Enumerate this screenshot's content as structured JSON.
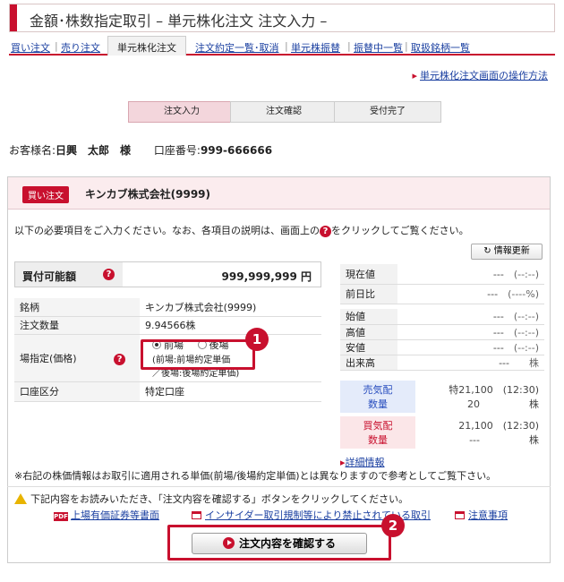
{
  "header": {
    "title": "金額･株数指定取引 – 単元株化注文 注文入力 –"
  },
  "tabs": [
    {
      "label": "買い注文"
    },
    {
      "label": "売り注文"
    },
    {
      "label": "単元株化注文"
    },
    {
      "label": "注文約定一覧･取消"
    },
    {
      "label": "単元株振替"
    },
    {
      "label": "振替中一覧"
    },
    {
      "label": "取扱銘柄一覧"
    }
  ],
  "help_link": "単元株化注文画面の操作方法",
  "steps": [
    "注文入力",
    "注文確認",
    "受付完了"
  ],
  "customer": {
    "name_label": "お客様名:",
    "name": "日興　太郎　様",
    "account_label": "口座番号:",
    "account": "999-666666"
  },
  "order": {
    "type_badge": "買い注文",
    "stock": "キンカブ株式会社(9999)"
  },
  "intro_before": "以下の必要項目をご入力ください。なお、各項目の説明は、画面上の",
  "intro_after": "をクリックしてご覧ください。",
  "refresh_label": "情報更新",
  "buying_power": {
    "label": "買付可能額",
    "value": "999,999,999 円"
  },
  "form": {
    "stock_label": "銘柄",
    "stock_value": "キンカブ株式会社(9999)",
    "qty_label": "注文数量",
    "qty_value": "9.94566株",
    "market_label": "場指定(価格)",
    "opt1": "前場",
    "opt2": "後場",
    "market_note1": "(前場:前場約定単価",
    "market_note2": "／後場:後場約定単価)",
    "account_label": "口座区分",
    "account_value": "特定口座"
  },
  "quote": {
    "rows": [
      {
        "label": "現在値",
        "value": "---",
        "time": "(--:--)"
      },
      {
        "label": "前日比",
        "value": "---",
        "time": "(----%)"
      },
      {
        "label": "始値",
        "value": "---",
        "time": "(--:--)"
      },
      {
        "label": "高値",
        "value": "---",
        "time": "(--:--)"
      },
      {
        "label": "安値",
        "value": "---",
        "time": "(--:--)"
      },
      {
        "label": "出来高",
        "value": "---",
        "time": "株"
      }
    ]
  },
  "orderbook": {
    "sell_label1": "売気配",
    "sell_label2": "数量",
    "sell_price": "特21,100",
    "sell_time": "(12:30)",
    "sell_qty": "20",
    "sell_unit": "株",
    "buy_label1": "買気配",
    "buy_label2": "数量",
    "buy_price": "21,100",
    "buy_time": "(12:30)",
    "buy_qty": "---",
    "buy_unit": "株"
  },
  "detail_link": "詳細情報",
  "note": "※右記の株価情報はお取引に適用される単価(前場/後場約定単価)とは異なりますので参考としてご覧下さい。",
  "warning": "下記内容をお読みいただき、「注文内容を確認する」ボタンをクリックしてください。",
  "doc_links": [
    "上場有価証券等書面",
    "インサイダー取引規制等により禁止されている取引",
    "注意事項"
  ],
  "pdf_label": "PDF",
  "confirm_button": "注文内容を確認する",
  "callouts": [
    "1",
    "2"
  ]
}
